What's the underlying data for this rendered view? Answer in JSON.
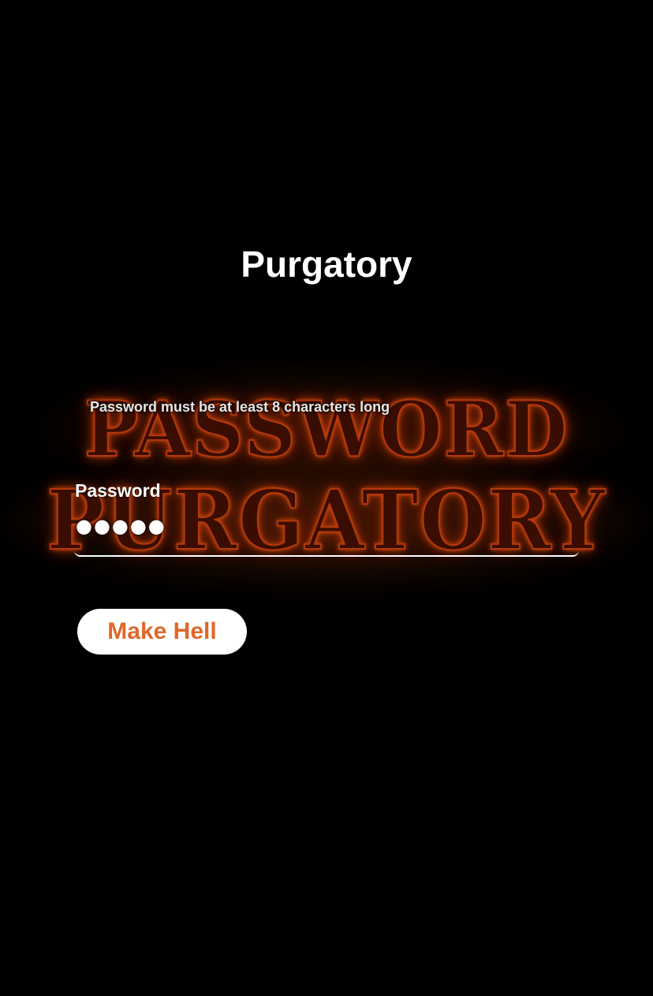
{
  "header": {
    "title": "Purgatory"
  },
  "banner": {
    "line1": "PASSWORD",
    "line2": "PURGATORY",
    "icon": "fire-banner-image"
  },
  "form": {
    "hint": "Password must be at least 8 characters long",
    "password_label": "Password",
    "password_value_masked": "●●●●●",
    "password_length": 5,
    "submit_label": "Make Hell"
  },
  "colors": {
    "background": "#000000",
    "text": "#ffffff",
    "button_bg": "#ffffff",
    "button_text": "#e0682a",
    "fire": "#b4380c"
  }
}
